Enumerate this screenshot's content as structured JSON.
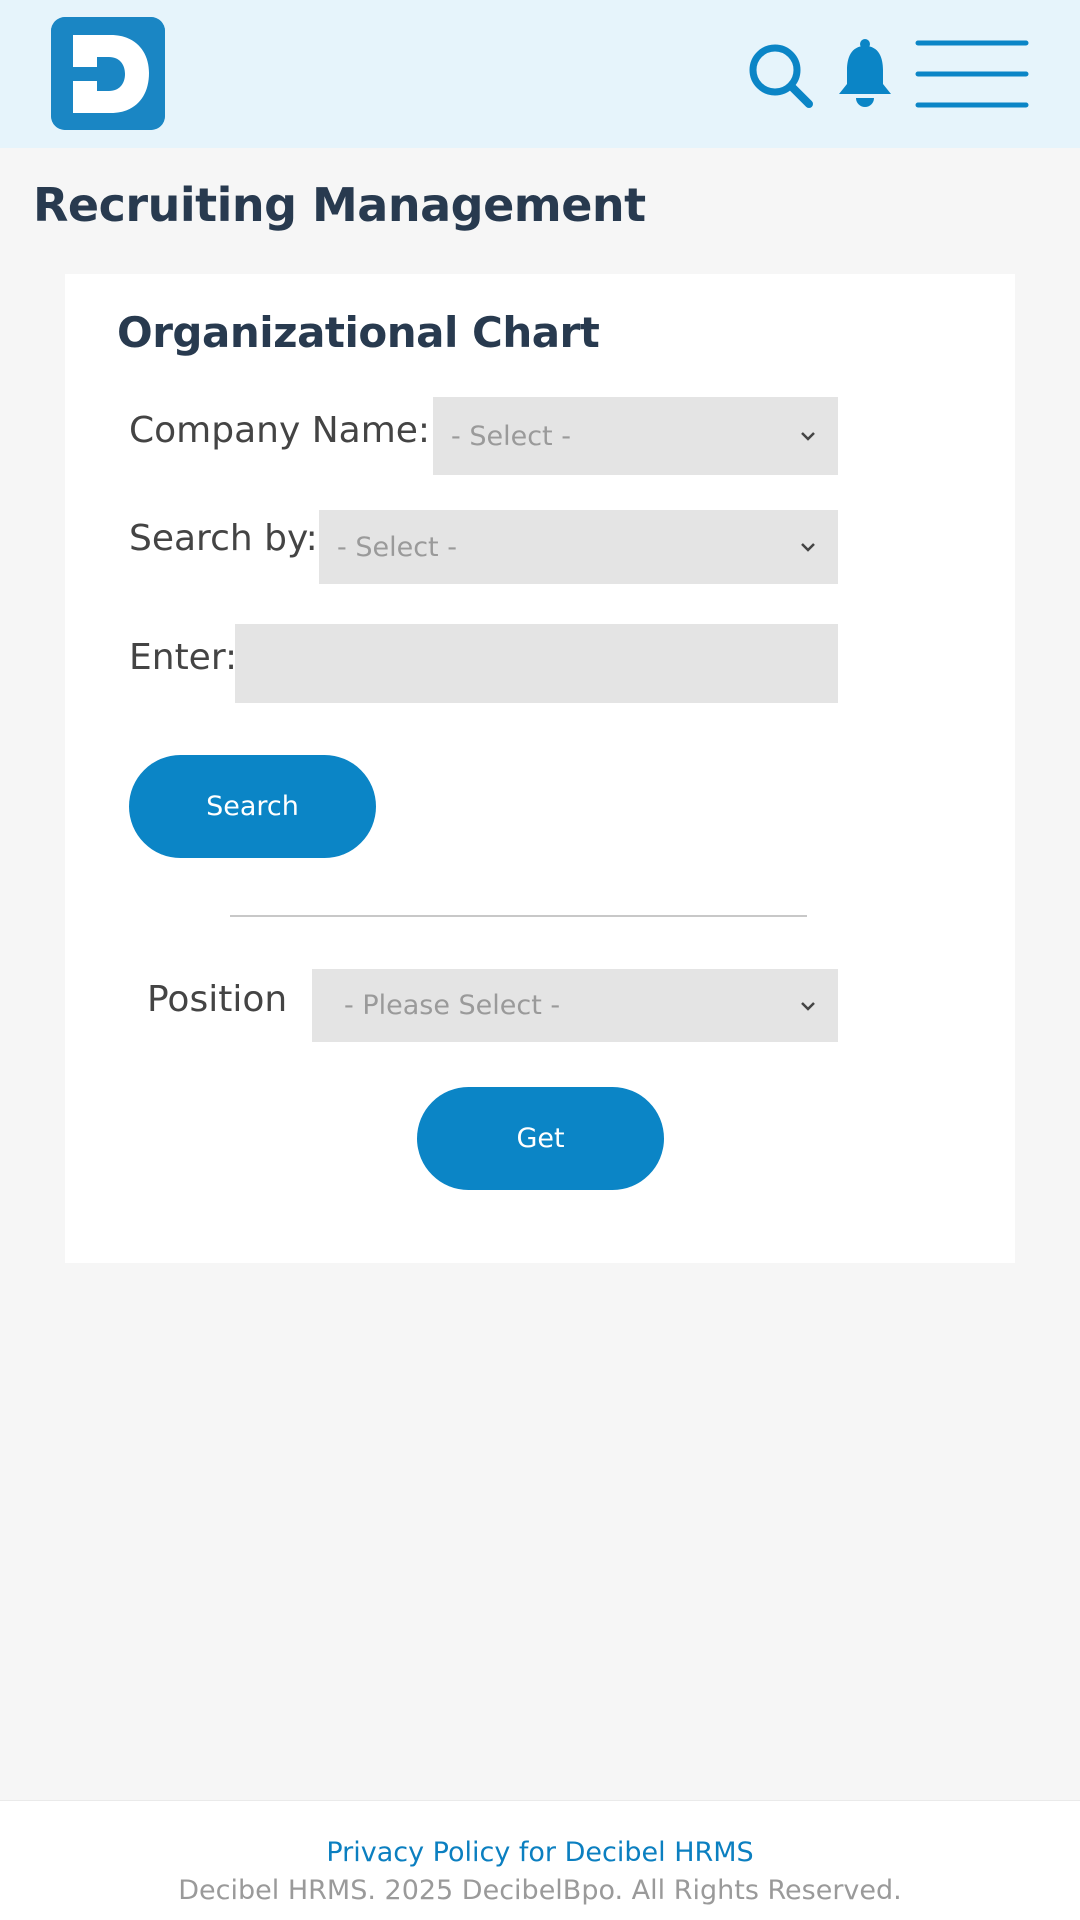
{
  "brand": {
    "logo_letter": "D",
    "accent": "#0b85c6",
    "header_bg": "#e6f4fb"
  },
  "header": {
    "icons": [
      "search-icon",
      "bell-icon",
      "hamburger-menu-icon"
    ]
  },
  "page": {
    "title": "Recruiting Management"
  },
  "card": {
    "title": "Organizational Chart",
    "company_label": "Company Name:",
    "company_select": "- Select -",
    "searchby_label": "Search by:",
    "searchby_select": "- Select -",
    "enter_label": "Enter:",
    "enter_value": "",
    "search_button": "Search",
    "position_label": "Position",
    "position_select": "- Please Select -",
    "get_button": "Get"
  },
  "footer": {
    "privacy_link": "Privacy Policy for Decibel HRMS",
    "copyright": "Decibel HRMS. 2025 DecibelBpo. All Rights Reserved."
  }
}
